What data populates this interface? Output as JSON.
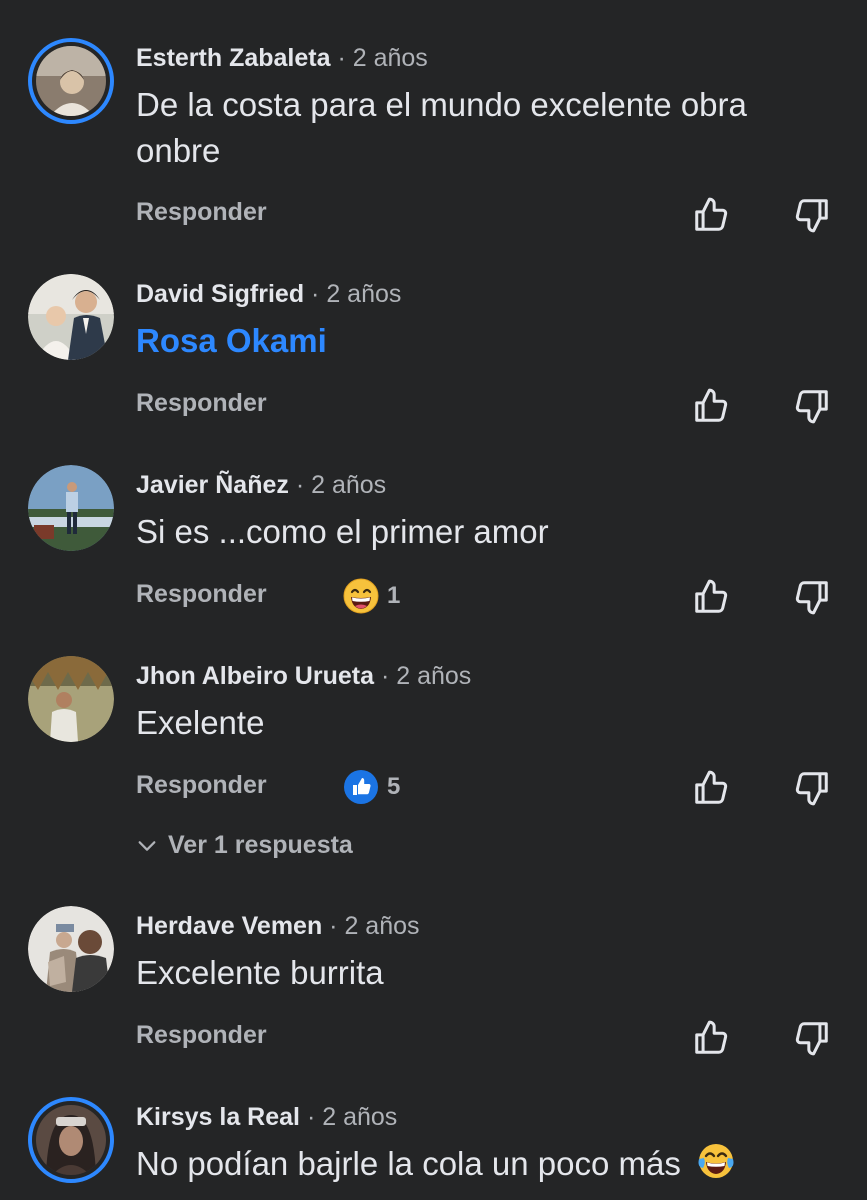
{
  "comments": [
    {
      "author": "Esterth Zabaleta",
      "time": "· 2 años",
      "text": "De la costa para el mundo excelente obra onbre",
      "reply_label": "Responder",
      "avatar_colors": [
        "#8a7c6e",
        "#d9c3a8",
        "#4a4038"
      ]
    },
    {
      "author": "David Sigfried",
      "time": "· 2 años",
      "text": "Rosa Okami",
      "reply_label": "Responder",
      "avatar_colors": [
        "#cfd0c8",
        "#f4f1ec",
        "#2e3a4a"
      ]
    },
    {
      "author": "Javier Ñañez",
      "time": "· 2 años",
      "text": "Si es ...como el primer amor",
      "reply_label": "Responder",
      "reaction": {
        "icon": "grinning-face-emoji",
        "count": "1"
      },
      "avatar_colors": [
        "#7aa0c4",
        "#3f5a3a",
        "#c9d6e2"
      ]
    },
    {
      "author": "Jhon Albeiro Urueta",
      "time": "· 2 años",
      "text": "Exelente",
      "reply_label": "Responder",
      "reaction": {
        "icon": "like-reaction-icon",
        "count": "5"
      },
      "view_replies": "Ver 1 respuesta",
      "avatar_colors": [
        "#6e6a4a",
        "#a8a27a",
        "#e8e6de"
      ]
    },
    {
      "author": "Herdave Vemen",
      "time": "· 2 años",
      "text": "Excelente burrita",
      "reply_label": "Responder",
      "avatar_colors": [
        "#e6e4e0",
        "#9a8a7a",
        "#3a3a3a"
      ]
    },
    {
      "author": "Kirsys la Real",
      "time": "· 2 años",
      "text": "No podían bajrle la cola un poco más",
      "text_emoji": "face-with-tears-of-joy-emoji",
      "avatar_colors": [
        "#5a4a42",
        "#b08a74",
        "#2a2220"
      ]
    }
  ],
  "colors": {
    "background": "#242526",
    "primary_text": "#e4e6eb",
    "secondary_text": "#b0b3b8",
    "accent": "#2d88ff"
  }
}
